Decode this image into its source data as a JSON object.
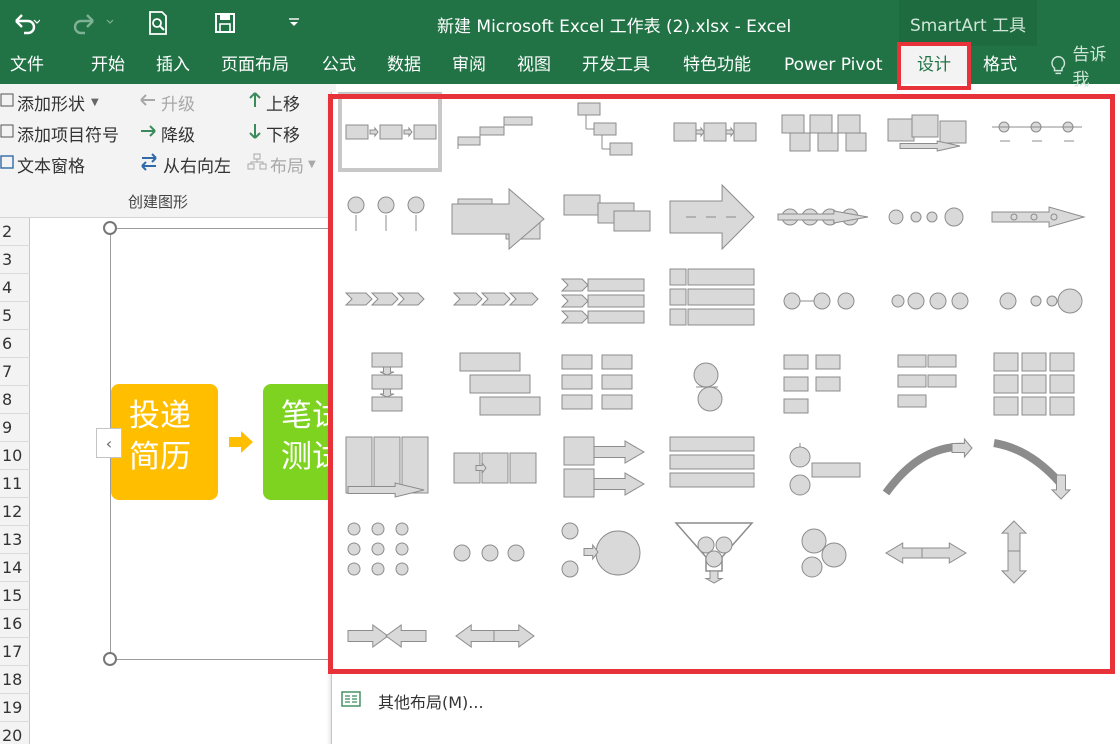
{
  "titlebar": {
    "title": "新建 Microsoft Excel 工作表 (2).xlsx - Excel",
    "contextual_tab_group": "SmartArt 工具"
  },
  "quick_access": [
    {
      "name": "undo-icon"
    },
    {
      "name": "redo-icon"
    },
    {
      "name": "print-preview-icon"
    },
    {
      "name": "save-icon"
    },
    {
      "name": "customize-qat-icon"
    }
  ],
  "tabs": [
    {
      "label": "文件"
    },
    {
      "label": "开始"
    },
    {
      "label": "插入"
    },
    {
      "label": "页面布局"
    },
    {
      "label": "公式"
    },
    {
      "label": "数据"
    },
    {
      "label": "审阅"
    },
    {
      "label": "视图"
    },
    {
      "label": "开发工具"
    },
    {
      "label": "特色功能"
    },
    {
      "label": "Power Pivot"
    },
    {
      "label": "设计",
      "active": true
    },
    {
      "label": "格式"
    }
  ],
  "tell_me": "告诉我",
  "ribbon": {
    "group_label": "创建图形",
    "add_shape": "添加形状",
    "add_bullet": "添加项目符号",
    "text_pane": "文本窗格",
    "promote": "升级",
    "demote": "降级",
    "right_to_left": "从右向左",
    "move_up": "上移",
    "move_down": "下移",
    "layout": "布局"
  },
  "row_headers": [
    "2",
    "3",
    "4",
    "5",
    "6",
    "7",
    "8",
    "9",
    "10",
    "11",
    "12",
    "13",
    "14",
    "15",
    "16",
    "17",
    "18",
    "19",
    "20"
  ],
  "smartart": {
    "box1_text": "投递\n简历",
    "box2_text": "笔试\n测试",
    "box1_color": "#ffbf00",
    "box2_color": "#7ed321",
    "toggle_glyph": "‹"
  },
  "gallery": {
    "selected_index": 0,
    "layouts": [
      "basic-process",
      "step-up-process",
      "step-down-process",
      "accent-process",
      "alternating-flow",
      "continuous-block-process",
      "timeline",
      "circle-accent-timeline",
      "basic-chevron-process",
      "closed-chevron-process",
      "process-arrows",
      "continuous-arrow-process",
      "circular-process",
      "basic-timeline",
      "chevron-list",
      "segmented-process",
      "repeating-bending-process",
      "vertical-chevron-list",
      "detailed-process",
      "equation-circles",
      "circle-process",
      "vertical-process",
      "staggered-process",
      "upward-arrow",
      "vertical-accent-list",
      "circular-arrow-process",
      "vertical-bending-process",
      "bending-process",
      "grid-process",
      "phased-process",
      "increasing-arrows-process",
      "descending-block-list",
      "vertical-circle-list",
      "up-arrow",
      "down-arrow",
      "random-to-result",
      "equation",
      "plus-and-minus",
      "funnel",
      "gear",
      "opposing-arrows",
      "arrow-ribbon",
      "converging-arrows",
      "diverging-arrows"
    ]
  },
  "more_layouts": "其他布局(M)...",
  "colors": {
    "excel_green": "#217346",
    "highlight_red": "#e8323a",
    "thumb_fill": "#d9d9d9",
    "thumb_stroke": "#8c8c8c"
  }
}
